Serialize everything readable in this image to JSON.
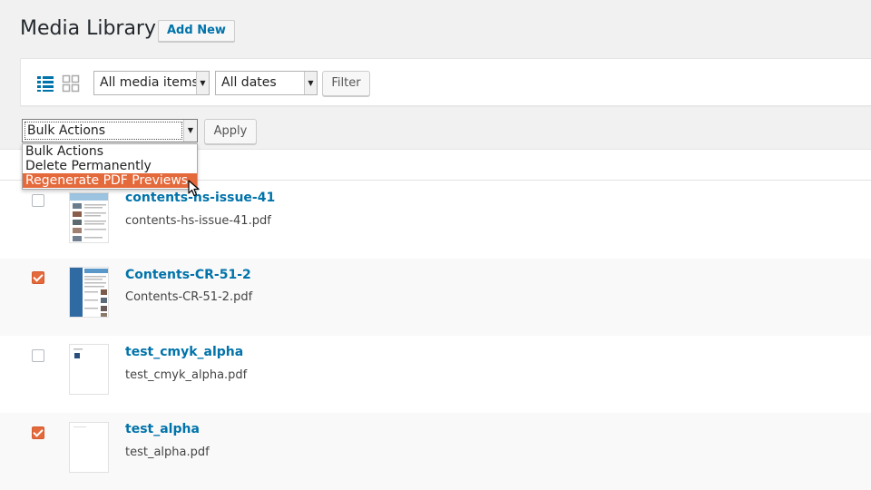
{
  "header": {
    "title": "Media Library",
    "add_new": "Add New"
  },
  "toolbar": {
    "media_filter": "All media items",
    "date_filter": "All dates",
    "filter_button": "Filter"
  },
  "bulk": {
    "selected": "Bulk Actions",
    "apply_button": "Apply",
    "options": [
      "Bulk Actions",
      "Delete Permanently",
      "Regenerate PDF Previews"
    ],
    "highlighted_index": 2
  },
  "items": [
    {
      "title": "contents-hs-issue-41",
      "filename": "contents-hs-issue-41.pdf",
      "checked": false
    },
    {
      "title": "Contents-CR-51-2",
      "filename": "Contents-CR-51-2.pdf",
      "checked": true
    },
    {
      "title": "test_cmyk_alpha",
      "filename": "test_cmyk_alpha.pdf",
      "checked": false
    },
    {
      "title": "test_alpha",
      "filename": "test_alpha.pdf",
      "checked": true
    }
  ],
  "colors": {
    "accent": "#e4693b",
    "link": "#0073aa"
  }
}
